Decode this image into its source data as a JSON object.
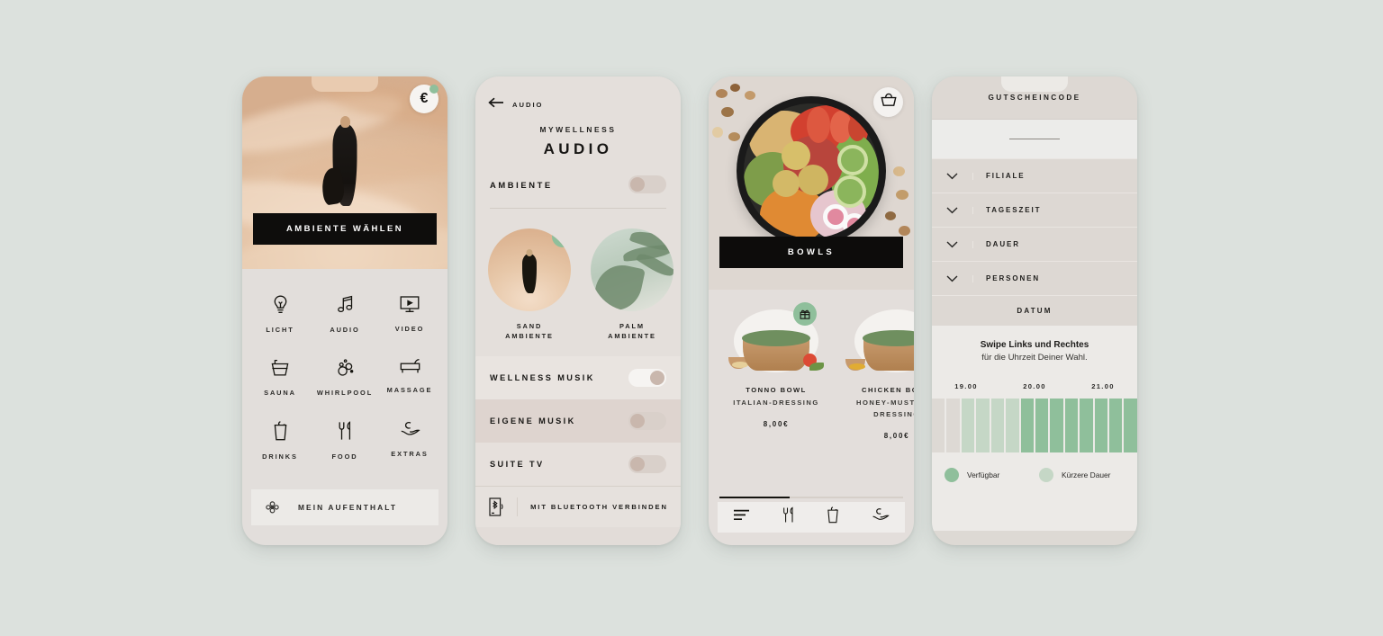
{
  "canvas": {
    "background": "#dce1dd"
  },
  "palette": {
    "ink": "#0e0d0c",
    "sage_strong": "#8fbf9b",
    "sage_soft": "#c5d7c6",
    "sand": "#e7c7a8",
    "panel": "#e2dedb"
  },
  "phone1": {
    "name": "ambiente-home",
    "badge": {
      "icon": "euro-icon",
      "symbol": "€",
      "status_dot": true
    },
    "hero_cta": "AMBIENTE WÄHLEN",
    "tiles": [
      {
        "icon": "lightbulb-icon",
        "label": "LICHT"
      },
      {
        "icon": "music-note-icon",
        "label": "AUDIO"
      },
      {
        "icon": "tv-icon",
        "label": "VIDEO"
      },
      {
        "icon": "sauna-bucket-icon",
        "label": "SAUNA"
      },
      {
        "icon": "whirlpool-bubbles-icon",
        "label": "WHIRLPOOL"
      },
      {
        "icon": "massage-table-icon",
        "label": "MASSAGE"
      },
      {
        "icon": "drink-cup-icon",
        "label": "DRINKS"
      },
      {
        "icon": "cutlery-icon",
        "label": "FOOD"
      },
      {
        "icon": "extras-hand-icon",
        "label": "EXTRAS"
      }
    ],
    "stay_bar": {
      "icon": "bell-flower-icon",
      "label": "MEIN AUFENTHALT"
    }
  },
  "phone2": {
    "name": "audio-settings",
    "back": {
      "icon": "arrow-left-icon",
      "label": "AUDIO"
    },
    "kicker": "MYWELLNESS",
    "title": "AUDIO",
    "ambiente": {
      "label": "AMBIENTE",
      "toggle": "off"
    },
    "cards": [
      {
        "name": "sand-ambiente",
        "line1": "SAND",
        "line2": "AMBIENTE",
        "selected": true
      },
      {
        "name": "palm-ambiente",
        "line1": "PALM",
        "line2": "AMBIENTE",
        "selected": false
      }
    ],
    "switches": [
      {
        "label": "WELLNESS MUSIK",
        "state": "on"
      },
      {
        "label": "EIGENE MUSIK",
        "state": "off"
      },
      {
        "label": "SUITE TV",
        "state": "off"
      }
    ],
    "bluetooth": {
      "icon": "bluetooth-device-icon",
      "label": "MIT BLUETOOTH VERBINDEN"
    }
  },
  "phone3": {
    "name": "bowls-menu",
    "cart": {
      "icon": "basket-icon"
    },
    "hero_cta": "BOWLS",
    "products": [
      {
        "name": "TONNO BOWL",
        "desc": "ITALIAN-DRESSING",
        "price": "8,00€",
        "badge": "gift-icon"
      },
      {
        "name": "CHICKEN BOWL",
        "desc": "HONEY-MUSTARD-DRESSING",
        "price": "8,00€",
        "badge": null
      }
    ],
    "tabs": [
      {
        "icon": "menu-lines-icon"
      },
      {
        "icon": "cutlery-icon"
      },
      {
        "icon": "drink-cup-icon"
      },
      {
        "icon": "extras-hand-icon"
      }
    ],
    "scroll_progress": 38
  },
  "phone4": {
    "name": "gutschein-booking",
    "header": "GUTSCHEINCODE",
    "code_input": {
      "placeholder": "",
      "value": ""
    },
    "accordions": [
      {
        "label": "FILIALE",
        "icon": "chevron-down-icon"
      },
      {
        "label": "TAGESZEIT",
        "icon": "chevron-down-icon"
      },
      {
        "label": "DAUER",
        "icon": "chevron-down-icon"
      },
      {
        "label": "PERSONEN",
        "icon": "chevron-down-icon"
      }
    ],
    "datum": "DATUM",
    "hint_bold": "Swipe Links und Rechtes",
    "hint_sub": "für die Uhrzeit Deiner Wahl.",
    "legend": [
      {
        "label": "Verfügbar",
        "color": "#8fbf9b"
      },
      {
        "label": "Kürzere Dauer",
        "color": "#c5d7c6"
      }
    ]
  },
  "chart_data": {
    "type": "bar",
    "title": "Swipe Links und Rechtes",
    "subtitle": "für die Uhrzeit Deiner Wahl.",
    "xlabel": "",
    "ylabel": "",
    "grid": false,
    "legend_position": "bottom",
    "categories": [
      "19.00",
      "20.00",
      "21.00"
    ],
    "tick_labels": [
      "19.00",
      "20.00",
      "21.00"
    ],
    "slots": [
      {
        "index": 0,
        "state": "unavailable",
        "color": "#ddd9d4"
      },
      {
        "index": 1,
        "state": "unavailable",
        "color": "#ddd9d4"
      },
      {
        "index": 2,
        "state": "kuerzere-dauer",
        "color": "#c5d7c6"
      },
      {
        "index": 3,
        "state": "kuerzere-dauer",
        "color": "#c5d7c6"
      },
      {
        "index": 4,
        "state": "kuerzere-dauer",
        "color": "#c5d7c6"
      },
      {
        "index": 5,
        "state": "kuerzere-dauer",
        "color": "#c5d7c6"
      },
      {
        "index": 6,
        "state": "verfuegbar",
        "color": "#8fbf9b"
      },
      {
        "index": 7,
        "state": "verfuegbar",
        "color": "#8fbf9b"
      },
      {
        "index": 8,
        "state": "verfuegbar",
        "color": "#8fbf9b"
      },
      {
        "index": 9,
        "state": "verfuegbar",
        "color": "#8fbf9b"
      },
      {
        "index": 10,
        "state": "verfuegbar",
        "color": "#8fbf9b"
      },
      {
        "index": 11,
        "state": "verfuegbar",
        "color": "#8fbf9b"
      },
      {
        "index": 12,
        "state": "verfuegbar",
        "color": "#8fbf9b"
      },
      {
        "index": 13,
        "state": "verfuegbar",
        "color": "#8fbf9b"
      }
    ],
    "values": [
      0,
      0,
      1,
      1,
      1,
      1,
      2,
      2,
      2,
      2,
      2,
      2,
      2,
      2
    ],
    "series": [
      {
        "name": "Verfügbar",
        "color": "#8fbf9b"
      },
      {
        "name": "Kürzere Dauer",
        "color": "#c5d7c6"
      }
    ]
  }
}
